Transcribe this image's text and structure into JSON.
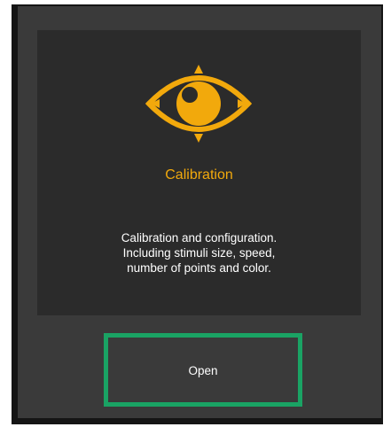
{
  "card": {
    "title": "Calibration",
    "description_lines": [
      "Calibration and configuration.",
      "Including stimuli size, speed,",
      "number of points and color."
    ],
    "icon": "eye-icon"
  },
  "actions": {
    "open_label": "Open"
  },
  "colors": {
    "accent": "#f2a90c",
    "highlight": "#1aa364",
    "card_bg": "#2b2b2b",
    "panel_bg": "#3a3a3a"
  }
}
